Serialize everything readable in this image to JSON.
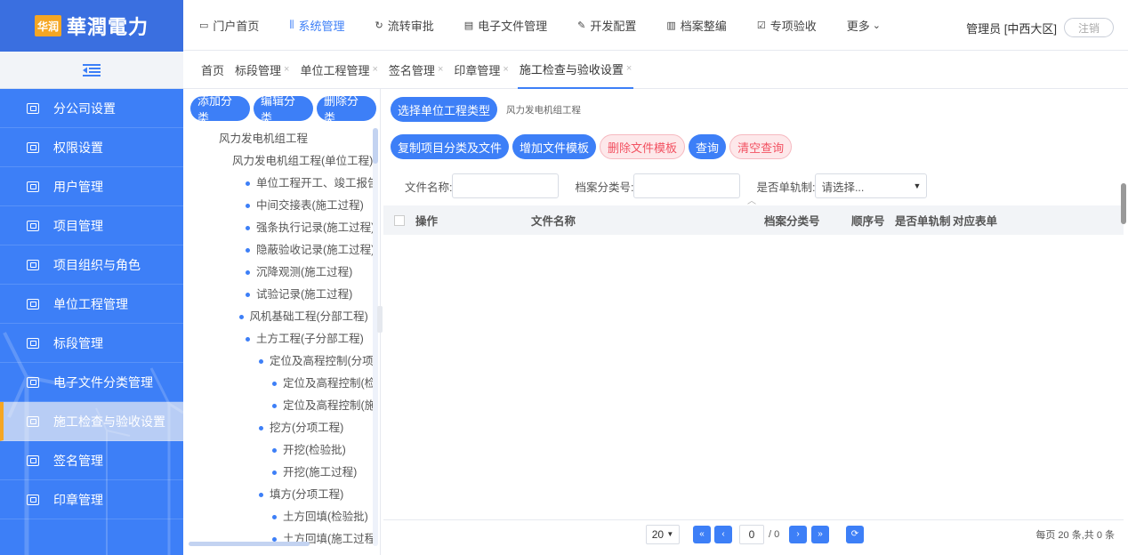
{
  "brand": {
    "logo_text": "华润",
    "name": "華潤電力"
  },
  "sidebar": {
    "toggle_icon": "menu-collapse-icon",
    "items": [
      {
        "label": "分公司设置"
      },
      {
        "label": "权限设置"
      },
      {
        "label": "用户管理"
      },
      {
        "label": "项目管理"
      },
      {
        "label": "项目组织与角色"
      },
      {
        "label": "单位工程管理"
      },
      {
        "label": "标段管理"
      },
      {
        "label": "电子文件分类管理"
      },
      {
        "label": "施工检查与验收设置",
        "active": true
      },
      {
        "label": "签名管理"
      },
      {
        "label": "印章管理"
      }
    ]
  },
  "topnav": {
    "items": [
      {
        "label": "门户首页",
        "icon": "monitor-icon"
      },
      {
        "label": "系统管理",
        "icon": "sliders-icon",
        "active": true
      },
      {
        "label": "流转审批",
        "icon": "refresh-icon"
      },
      {
        "label": "电子文件管理",
        "icon": "file-icon"
      },
      {
        "label": "开发配置",
        "icon": "wrench-icon"
      },
      {
        "label": "档案整编",
        "icon": "barcode-icon"
      },
      {
        "label": "专项验收",
        "icon": "checkbox-icon"
      },
      {
        "label": "更多",
        "icon": "chevron-down-icon"
      }
    ],
    "user": "管理员 [中西大区]",
    "logout": "注销"
  },
  "tabs": [
    {
      "label": "首页",
      "closable": false
    },
    {
      "label": "标段管理",
      "closable": true
    },
    {
      "label": "单位工程管理",
      "closable": true
    },
    {
      "label": "签名管理",
      "closable": true
    },
    {
      "label": "印章管理",
      "closable": true
    },
    {
      "label": "施工检查与验收设置",
      "closable": true,
      "active": true
    }
  ],
  "tree_panel": {
    "buttons": [
      "添加分类",
      "编辑分类",
      "删除分类"
    ],
    "nodes": [
      {
        "label": "风力发电机组工程",
        "level": 0,
        "dot": false
      },
      {
        "label": "风力发电机组工程(单位工程)",
        "level": 1,
        "dot": false
      },
      {
        "label": "单位工程开工、竣工报告(单",
        "level": 2,
        "dot": true
      },
      {
        "label": "中间交接表(施工过程)",
        "level": 2,
        "dot": true
      },
      {
        "label": "强条执行记录(施工过程)",
        "level": 2,
        "dot": true
      },
      {
        "label": "隐蔽验收记录(施工过程)",
        "level": 2,
        "dot": true
      },
      {
        "label": "沉降观测(施工过程)",
        "level": 2,
        "dot": true
      },
      {
        "label": "试验记录(施工过程)",
        "level": 2,
        "dot": true
      },
      {
        "label": "风机基础工程(分部工程)",
        "level": 1.5,
        "dot": true
      },
      {
        "label": "土方工程(子分部工程)",
        "level": 2,
        "dot": true
      },
      {
        "label": "定位及高程控制(分项工",
        "level": 3,
        "dot": true
      },
      {
        "label": "定位及高程控制(检",
        "level": 4,
        "dot": true
      },
      {
        "label": "定位及高程控制(施",
        "level": 4,
        "dot": true
      },
      {
        "label": "挖方(分项工程)",
        "level": 3,
        "dot": true
      },
      {
        "label": "开挖(检验批)",
        "level": 4,
        "dot": true
      },
      {
        "label": "开挖(施工过程)",
        "level": 4,
        "dot": true
      },
      {
        "label": "填方(分项工程)",
        "level": 3,
        "dot": true
      },
      {
        "label": "土方回填(检验批)",
        "level": 4,
        "dot": true
      },
      {
        "label": "土方回填(施工过程",
        "level": 4,
        "dot": true
      }
    ]
  },
  "main": {
    "select_type_button": "选择单位工程类型",
    "project_type": "风力发电机组工程",
    "action_buttons": [
      {
        "label": "复制项目分类及文件",
        "style": "primary"
      },
      {
        "label": "增加文件模板",
        "style": "primary"
      },
      {
        "label": "删除文件模板",
        "style": "danger"
      },
      {
        "label": "查询",
        "style": "primary"
      },
      {
        "label": "清空查询",
        "style": "danger"
      }
    ],
    "filters": {
      "file_name_label": "文件名称:",
      "file_name_value": "",
      "archive_no_label": "档案分类号:",
      "archive_no_value": "",
      "single_track_label": "是否单轨制:",
      "single_track_placeholder": "请选择..."
    },
    "table": {
      "columns": [
        "操作",
        "文件名称",
        "档案分类号",
        "顺序号",
        "是否单轨制",
        "对应表单"
      ],
      "rows": []
    },
    "pager": {
      "page_size": "20",
      "page_input": "0",
      "total_pages": "/ 0",
      "info": "每页 20 条,共 0 条"
    }
  }
}
